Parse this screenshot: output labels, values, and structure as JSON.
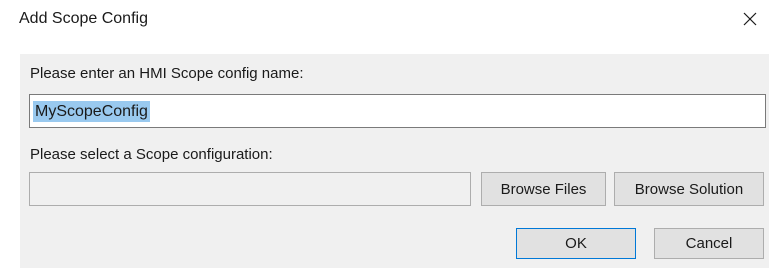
{
  "window": {
    "title": "Add Scope Config",
    "close_icon": "close-icon"
  },
  "form": {
    "name_label": "Please enter an HMI Scope config name:",
    "name_value": "MyScopeConfig",
    "scope_label": "Please select a Scope configuration:",
    "scope_path_value": ""
  },
  "buttons": {
    "browse_files": "Browse Files",
    "browse_solution": "Browse Solution",
    "ok": "OK",
    "cancel": "Cancel"
  }
}
